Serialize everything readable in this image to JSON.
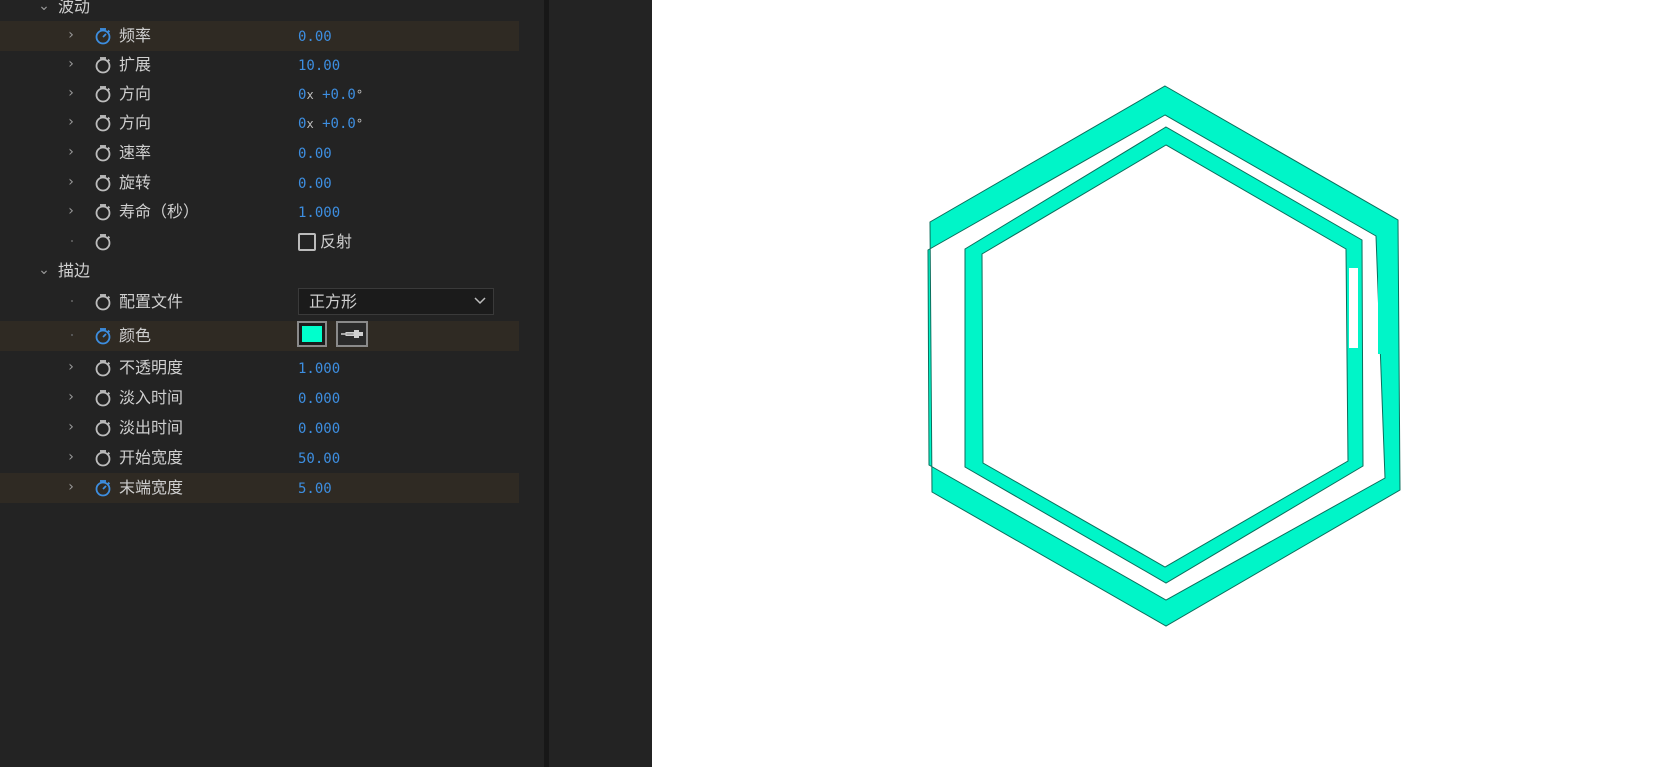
{
  "colors": {
    "panel_bg": "#232323",
    "accent_value": "#3d8ee0",
    "stroke_color": "#00ffcc",
    "canvas_bg": "#ffffff"
  },
  "sections": {
    "wave": "波动",
    "stroke": "描边"
  },
  "wave_props": [
    {
      "label": "频率",
      "value": "0.00",
      "keyframed": true
    },
    {
      "label": "扩展",
      "value": "10.00"
    },
    {
      "label": "方向",
      "value_turns": "0",
      "value_x": "x",
      "value_deg": "+0.0",
      "value_unit": "°"
    },
    {
      "label": "方向",
      "value_turns": "0",
      "value_x": "x",
      "value_deg": "+0.0",
      "value_unit": "°"
    },
    {
      "label": "速率",
      "value": "0.00"
    },
    {
      "label": "旋转",
      "value": "0.00"
    },
    {
      "label": "寿命（秒）",
      "value": "1.000"
    }
  ],
  "reflect": {
    "label": "反射",
    "checked": false
  },
  "stroke_props": {
    "profile": {
      "label": "配置文件",
      "value": "正方形"
    },
    "color": {
      "label": "颜色",
      "value": "#00ffcc"
    },
    "opacity": {
      "label": "不透明度",
      "value": "1.000"
    },
    "fade_in": {
      "label": "淡入时间",
      "value": "0.000"
    },
    "fade_out": {
      "label": "淡出时间",
      "value": "0.000"
    },
    "start_width": {
      "label": "开始宽度",
      "value": "50.00"
    },
    "end_width": {
      "label": "末端宽度",
      "value": "5.00",
      "keyframed": true
    }
  },
  "icons": {
    "stopwatch": "stopwatch-icon",
    "twirl": "chevron-right-icon",
    "eyedropper": "eyedropper-icon"
  }
}
